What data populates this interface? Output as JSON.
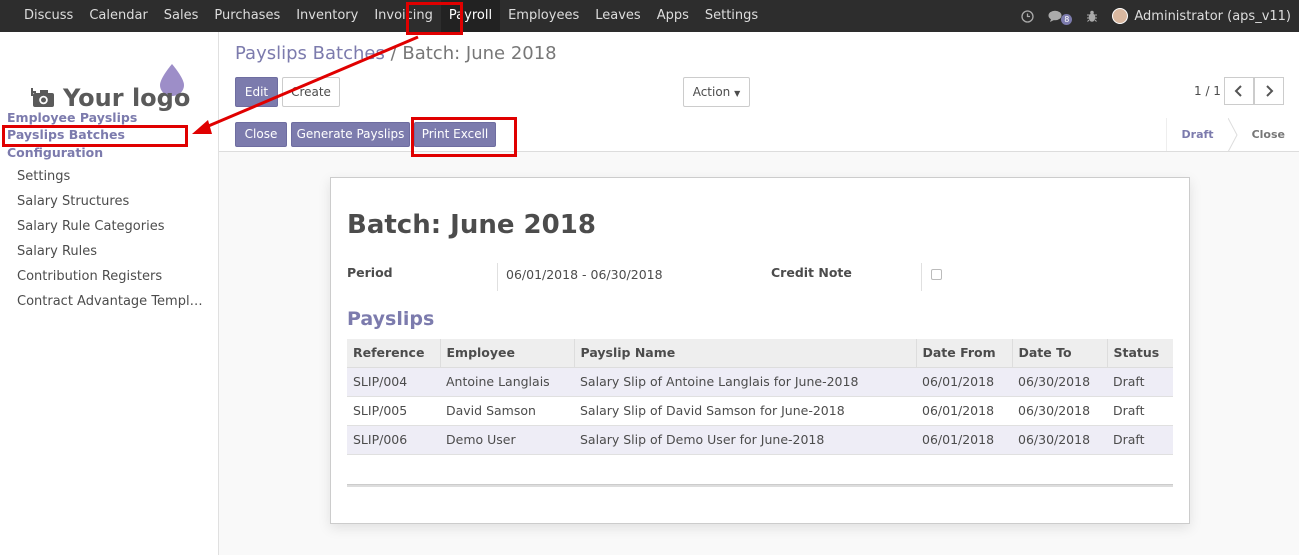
{
  "topbar": {
    "menu": [
      "Discuss",
      "Calendar",
      "Sales",
      "Purchases",
      "Inventory",
      "Invoicing",
      "Payroll",
      "Employees",
      "Leaves",
      "Apps",
      "Settings"
    ],
    "active": "Payroll",
    "messages_count": "8",
    "user": "Administrator (aps_v11)"
  },
  "sidebar": {
    "logo_text": "Your logo",
    "employee_payslips": "Employee Payslips",
    "payslips_batches": "Payslips Batches",
    "configuration": "Configuration",
    "config_items": [
      "Settings",
      "Salary Structures",
      "Salary Rule Categories",
      "Salary Rules",
      "Contribution Registers",
      "Contract Advantage Templ…"
    ]
  },
  "breadcrumb": {
    "parent": "Payslips Batches",
    "separator": "/",
    "current": "Batch: June 2018"
  },
  "buttons": {
    "edit": "Edit",
    "create": "Create",
    "action": "Action",
    "close": "Close",
    "generate_payslips": "Generate Payslips",
    "print_excel": "Print Excell"
  },
  "pager": {
    "value": "1 / 1"
  },
  "status": {
    "stages": [
      "Draft",
      "Close"
    ],
    "current": "Draft"
  },
  "form": {
    "title": "Batch: June 2018",
    "period_label": "Period",
    "period_value": "06/01/2018 - 06/30/2018",
    "credit_note_label": "Credit Note",
    "payslips_section": "Payslips",
    "columns": [
      "Reference",
      "Employee",
      "Payslip Name",
      "Date From",
      "Date To",
      "Status"
    ],
    "rows": [
      [
        "SLIP/004",
        "Antoine Langlais",
        "Salary Slip of Antoine Langlais for June-2018",
        "06/01/2018",
        "06/30/2018",
        "Draft"
      ],
      [
        "SLIP/005",
        "David Samson",
        "Salary Slip of David Samson for June-2018",
        "06/01/2018",
        "06/30/2018",
        "Draft"
      ],
      [
        "SLIP/006",
        "Demo User",
        "Salary Slip of Demo User for June-2018",
        "06/01/2018",
        "06/30/2018",
        "Draft"
      ]
    ]
  },
  "colors": {
    "brand": "#7c7bad",
    "topbar": "#2d2d2d",
    "annotation": "#e00000"
  }
}
